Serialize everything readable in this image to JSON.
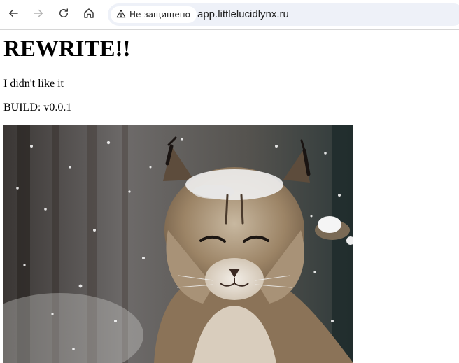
{
  "browser": {
    "nav": {
      "back_icon": "arrow-left-icon",
      "forward_icon": "arrow-right-icon",
      "reload_icon": "reload-icon",
      "home_icon": "home-icon"
    },
    "security_label": "Не защищено",
    "security_icon": "warning-triangle-icon",
    "url": "app.littlelucidlynx.ru"
  },
  "page": {
    "title": "REWRITE!!",
    "paragraphs": [
      "I didn't like it",
      "BUILD: v0.0.1"
    ],
    "image": {
      "subject": "lynx-in-snow"
    }
  },
  "colors": {
    "omnibox_bg": "#eef1f8",
    "toolbar_border": "#d6d6d6",
    "icon_active": "#3c3c3c",
    "icon_disabled": "#b0b0b0"
  }
}
